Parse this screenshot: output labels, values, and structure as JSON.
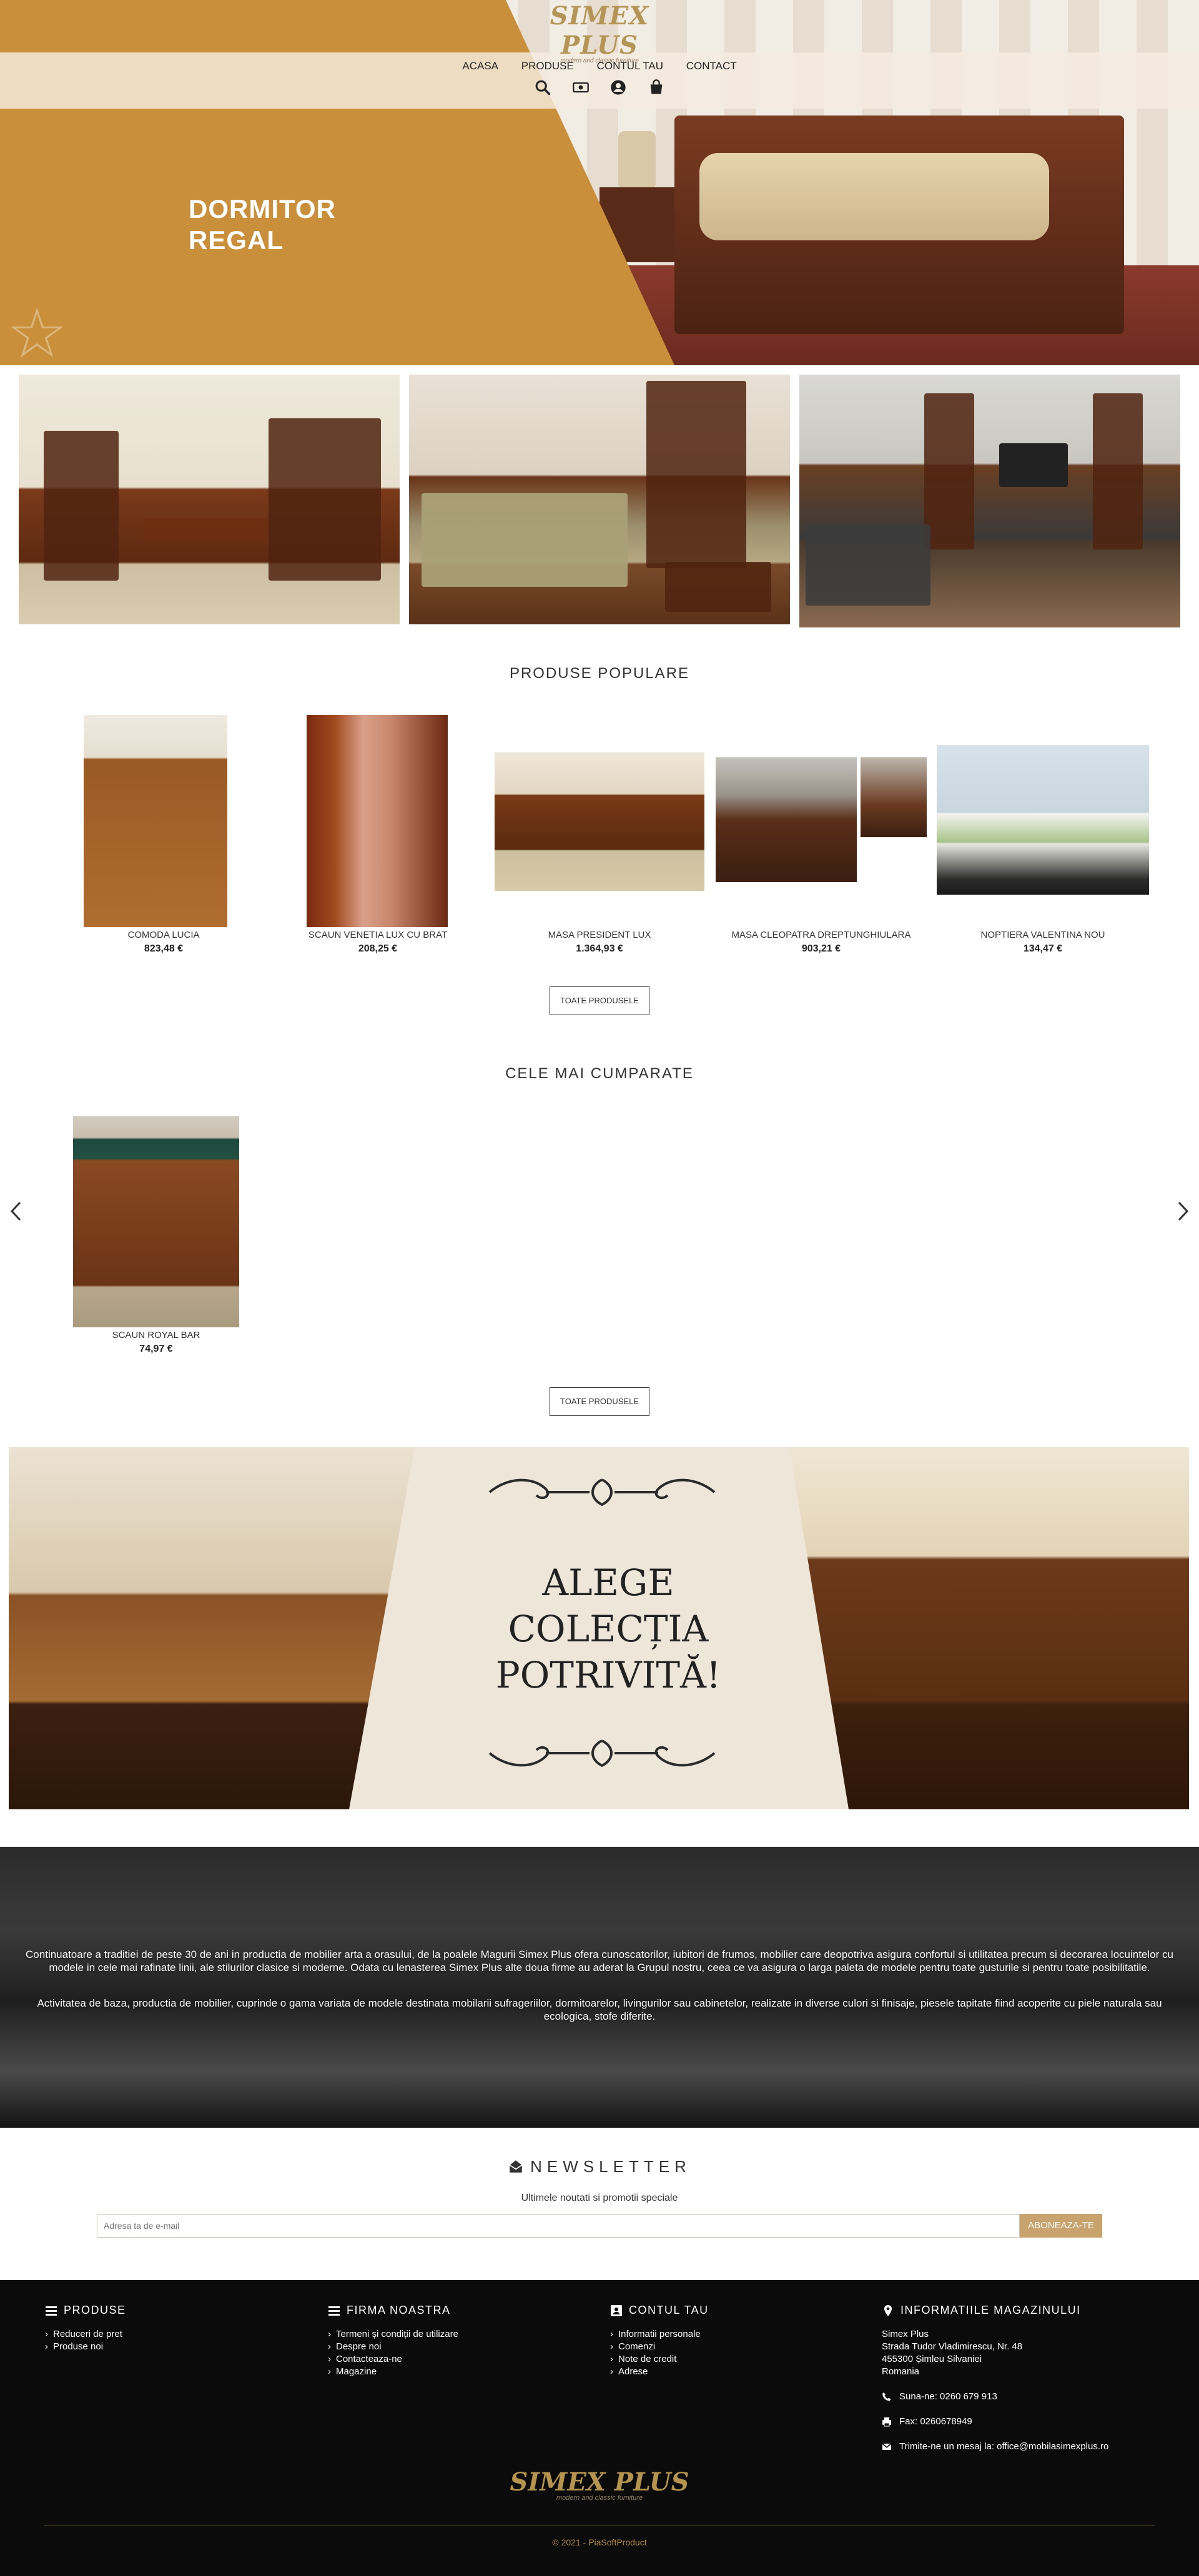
{
  "brand": {
    "logo_text": "SIMEX PLUS",
    "logo_tagline": "modern and classic furniture",
    "accent": "#c98f3a",
    "button_accent": "#c9a36d"
  },
  "nav": {
    "items": [
      "ACASA",
      "PRODUSE",
      "CONTUL TAU",
      "CONTACT"
    ],
    "icons": [
      "search-icon",
      "money-icon",
      "user-icon",
      "cart-icon"
    ]
  },
  "hero": {
    "title_line1": "DORMITOR",
    "title_line2": "REGAL"
  },
  "popular": {
    "title": "PRODUSE POPULARE",
    "products": [
      {
        "name": "COMODA LUCIA",
        "price": "823,48 €"
      },
      {
        "name": "SCAUN VENETIA LUX CU BRAT",
        "price": "208,25 €"
      },
      {
        "name": "MASA PRESIDENT LUX",
        "price": "1.364,93 €"
      },
      {
        "name": "MASA CLEOPATRA DREPTUNGHIULARA",
        "price": "903,21 €"
      },
      {
        "name": "NOPTIERA VALENTINA NOU",
        "price": "134,47 €"
      }
    ],
    "button": "TOATE PRODUSELE"
  },
  "bestsellers": {
    "title": "CELE MAI CUMPARATE",
    "products": [
      {
        "name": "SCAUN ROYAL BAR",
        "price": "74,97 €"
      }
    ],
    "button": "TOATE PRODUSELE",
    "prev": "‹",
    "next": "›"
  },
  "banner": {
    "line1": "ALEGE",
    "line2": "COLECȚIA",
    "line3": "POTRIVITĂ!"
  },
  "about": {
    "p1": "Continuatoare a traditiei de peste 30 de ani in productia de mobilier arta a orasului, de la poalele Magurii Simex Plus ofera cunoscatorilor, iubitori de frumos, mobilier care deopotriva asigura confortul si utilitatea precum si decorarea locuintelor cu modele in cele mai rafinate linii, ale stilurilor clasice si moderne. Odata cu lenasterea Simex Plus alte doua firme au aderat la Grupul nostru, ceea ce va asigura o larga paleta de modele pentru toate gusturile si pentru toate posibilitatile.",
    "p2": "Activitatea de baza, productia de mobilier, cuprinde o gama variata de modele destinata mobilarii sufrageriilor, dormitoarelor, livingurilor sau cabinetelor, realizate in diverse culori si finisaje, piesele tapitate fiind acoperite cu piele naturala sau ecologica, stofe diferite."
  },
  "newsletter": {
    "title": "NEWSLETTER",
    "subtitle": "Ultimele noutati si promotii speciale",
    "placeholder": "Adresa ta de e-mail",
    "button": "ABONEAZA-TE"
  },
  "footer": {
    "produse": {
      "title": "PRODUSE",
      "items": [
        "Reduceri de pret",
        "Produse noi"
      ]
    },
    "firma": {
      "title": "FIRMA NOASTRA",
      "items": [
        "Termeni și condiții de utilizare",
        "Despre noi",
        "Contacteaza-ne",
        "Magazine"
      ]
    },
    "cont": {
      "title": "CONTUL TAU",
      "items": [
        "Informatii personale",
        "Comenzi",
        "Note de credit",
        "Adrese"
      ]
    },
    "info": {
      "title": "INFORMATIILE MAGAZINULUI",
      "address": [
        "Simex Plus",
        "Strada Tudor Vladimirescu, Nr. 48",
        "455300 Șimleu Silvaniei",
        "Romania"
      ],
      "phone": "Suna-ne: 0260 679 913",
      "fax": "Fax: 0260678949",
      "email": "Trimite-ne un mesaj la: office@mobilasimexplus.ro"
    },
    "copyright": "© 2021 - PiaSoftProduct"
  }
}
